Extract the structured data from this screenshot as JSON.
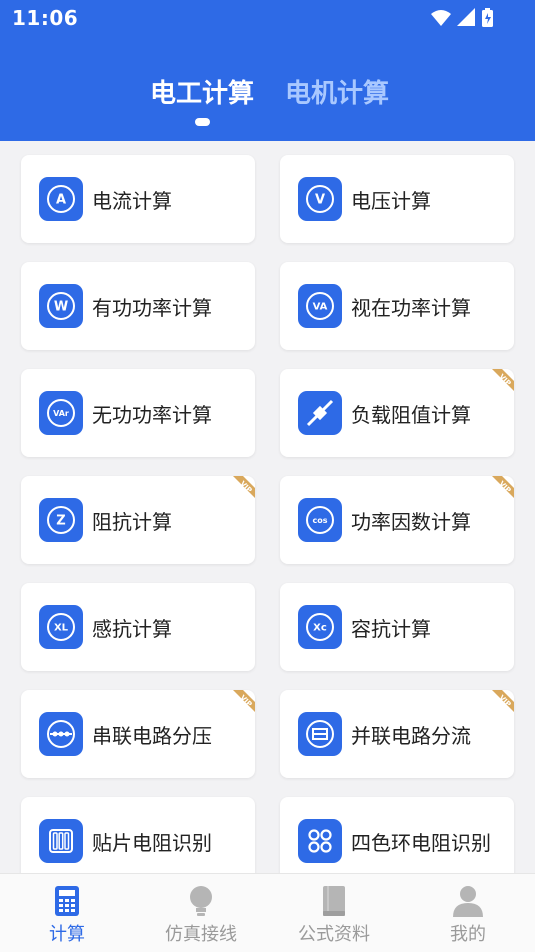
{
  "status_bar": {
    "time": "11:06"
  },
  "tabs": [
    {
      "label": "电工计算"
    },
    {
      "label": "电机计算"
    }
  ],
  "cards": [
    {
      "label": "电流计算",
      "icon": "ammeter-icon",
      "icon_text": "A",
      "vip": false
    },
    {
      "label": "电压计算",
      "icon": "voltmeter-icon",
      "icon_text": "V",
      "vip": false
    },
    {
      "label": "有功功率计算",
      "icon": "watt-icon",
      "icon_text": "W",
      "vip": false
    },
    {
      "label": "视在功率计算",
      "icon": "va-icon",
      "icon_text": "VA",
      "vip": false
    },
    {
      "label": "无功功率计算",
      "icon": "var-icon",
      "icon_text": "VAr",
      "vip": false
    },
    {
      "label": "负载阻值计算",
      "icon": "resistor-icon",
      "icon_text": "",
      "vip": true
    },
    {
      "label": "阻抗计算",
      "icon": "impedance-icon",
      "icon_text": "Z",
      "vip": true
    },
    {
      "label": "功率因数计算",
      "icon": "cos-icon",
      "icon_text": "cos",
      "vip": true
    },
    {
      "label": "感抗计算",
      "icon": "inductive-reactance-icon",
      "icon_text": "XL",
      "vip": false
    },
    {
      "label": "容抗计算",
      "icon": "capacitive-reactance-icon",
      "icon_text": "Xc",
      "vip": false
    },
    {
      "label": "串联电路分压",
      "icon": "series-circuit-icon",
      "icon_text": "",
      "vip": true
    },
    {
      "label": "并联电路分流",
      "icon": "parallel-circuit-icon",
      "icon_text": "",
      "vip": true
    },
    {
      "label": "贴片电阻识别",
      "icon": "smd-resistor-icon",
      "icon_text": "",
      "vip": false
    },
    {
      "label": "四色环电阻识别",
      "icon": "color-ring-icon",
      "icon_text": "",
      "vip": false
    }
  ],
  "vip_label": "VIP",
  "bottom_nav": [
    {
      "label": "计算",
      "icon": "calculator-icon"
    },
    {
      "label": "仿真接线",
      "icon": "bulb-icon"
    },
    {
      "label": "公式资料",
      "icon": "book-icon"
    },
    {
      "label": "我的",
      "icon": "user-icon"
    }
  ],
  "colors": {
    "primary": "#2e6ae6",
    "tab_inactive": "#a9c8ff",
    "vip": "#d9a85c",
    "nav_inactive": "#9a9a9a"
  }
}
